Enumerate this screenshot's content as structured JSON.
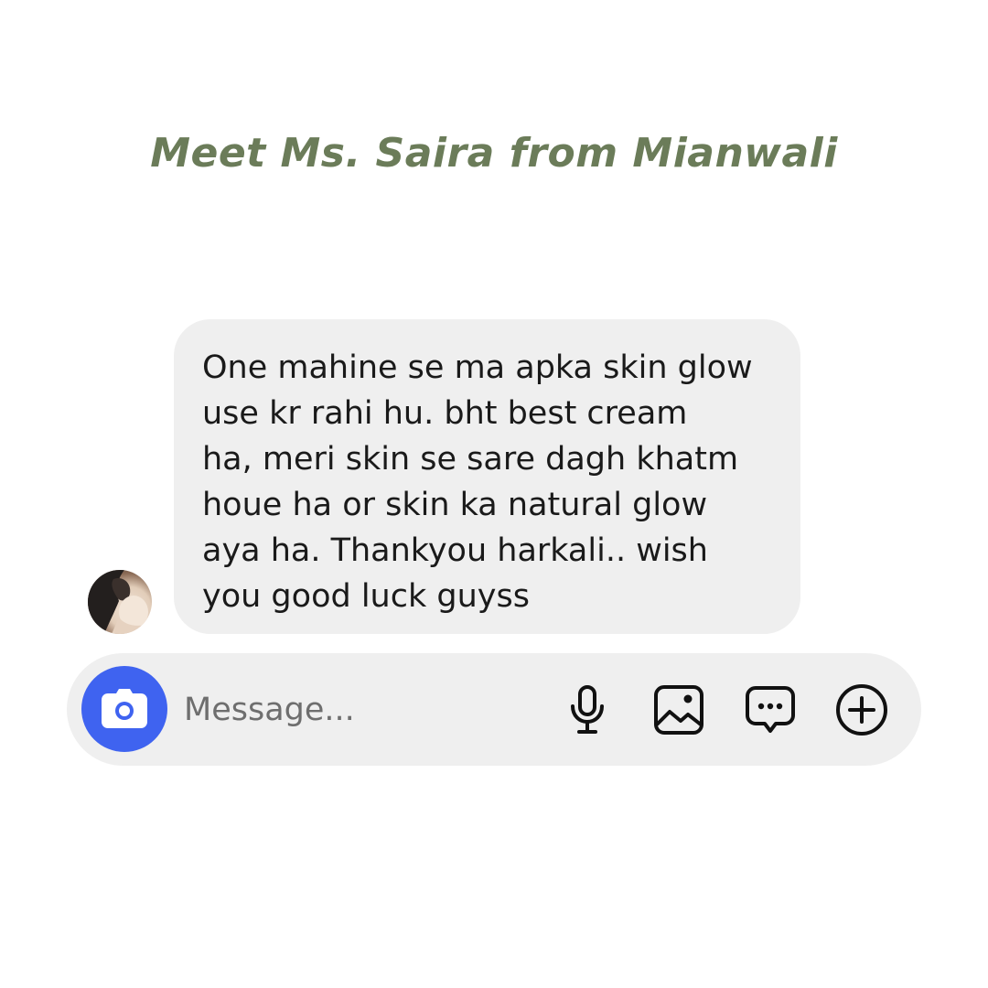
{
  "header": {
    "title": "Meet Ms. Saira from Mianwali"
  },
  "chat": {
    "message": "One mahine se ma apka skin glow\nuse kr rahi hu. bht best cream\nha, meri skin se sare dagh khatm\nhoue ha or skin ka natural glow\naya ha. Thankyou harkali.. wish\nyou good luck guyss",
    "avatar_icon": "user-avatar"
  },
  "composer": {
    "placeholder": "Message...",
    "icons": [
      "camera-icon",
      "microphone-icon",
      "gallery-icon",
      "sticker-icon",
      "plus-circle-icon"
    ],
    "accent_color": "#3f63f0"
  },
  "colors": {
    "title": "#6b7c59",
    "bubble_bg": "#efefef",
    "composer_bg": "#efefef"
  }
}
